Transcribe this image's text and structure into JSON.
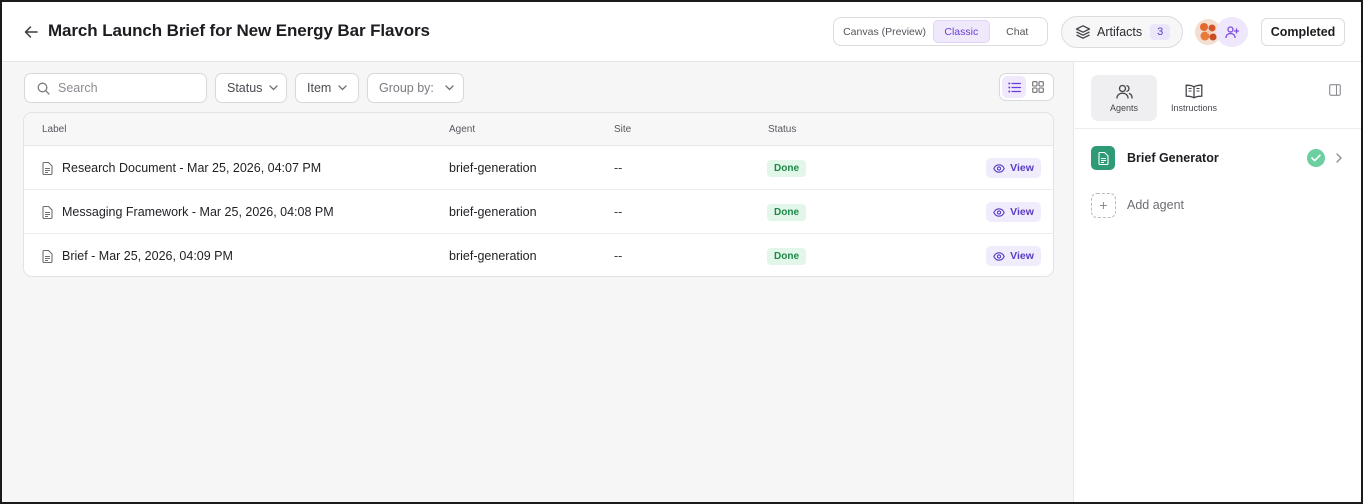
{
  "header": {
    "title": "March Launch Brief for New Energy Bar Flavors",
    "view_modes": {
      "canvas": "Canvas (Preview)",
      "classic": "Classic",
      "chat": "Chat",
      "active": "Classic"
    },
    "artifacts": {
      "label": "Artifacts",
      "count": "3"
    },
    "status_button": "Completed"
  },
  "toolbar": {
    "search_placeholder": "Search",
    "filters": {
      "status": "Status",
      "item": "Item",
      "group_by": "Group by:"
    },
    "layout_active": "list"
  },
  "table": {
    "columns": {
      "label": "Label",
      "agent": "Agent",
      "site": "Site",
      "status": "Status"
    },
    "rows": [
      {
        "label": "Research Document - Mar 25, 2026, 04:07 PM",
        "agent": "brief-generation",
        "site": "--",
        "status": "Done",
        "action": "View"
      },
      {
        "label": "Messaging Framework - Mar 25, 2026, 04:08 PM",
        "agent": "brief-generation",
        "site": "--",
        "status": "Done",
        "action": "View"
      },
      {
        "label": "Brief - Mar 25, 2026, 04:09 PM",
        "agent": "brief-generation",
        "site": "--",
        "status": "Done",
        "action": "View"
      }
    ]
  },
  "panel": {
    "tabs": {
      "agents": "Agents",
      "instructions": "Instructions",
      "active": "Agents"
    },
    "agents": [
      {
        "name": "Brief Generator",
        "status": "complete"
      }
    ],
    "add_agent_label": "Add agent"
  },
  "colors": {
    "accent": "#6a3fd6",
    "done_bg": "#e3f6ea",
    "done_text": "#1b8a48",
    "agent_icon": "#2f9b76"
  },
  "icons": {
    "back": "arrow-left-icon",
    "artifacts": "layers-icon",
    "add_user": "user-plus-icon",
    "search": "search-icon",
    "row": "document-icon",
    "view": "eye-icon",
    "agents": "users-icon",
    "instructions": "book-open-icon",
    "collapse": "panel-collapse-icon"
  }
}
